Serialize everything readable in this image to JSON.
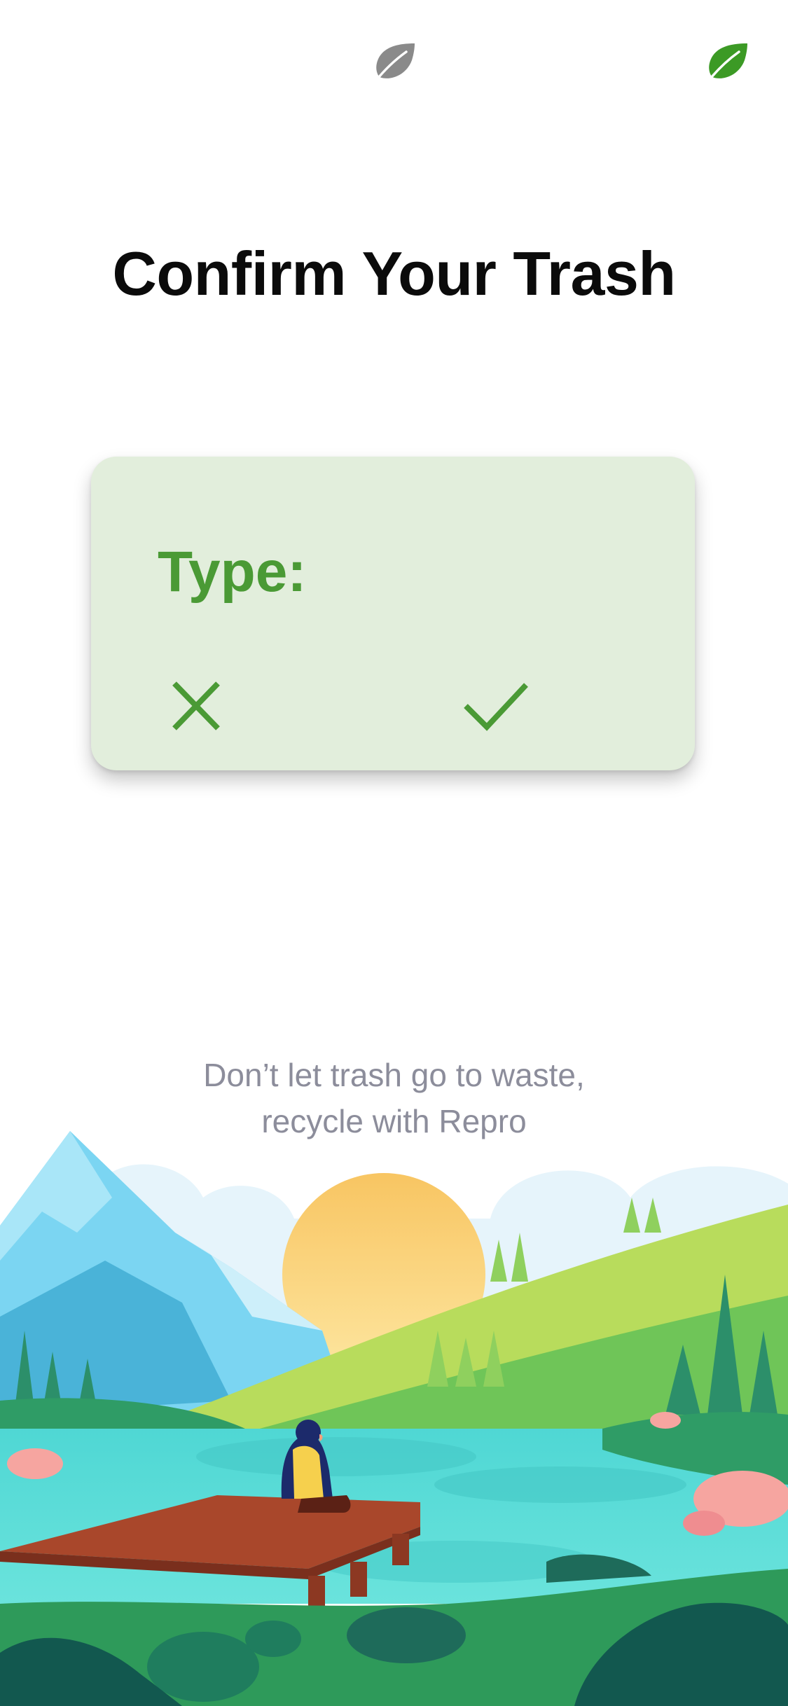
{
  "header": {
    "leaf_inactive_icon": "leaf-icon",
    "leaf_active_icon": "leaf-icon",
    "inactive_color": "#8a8a8a",
    "active_color": "#3c9a25"
  },
  "main": {
    "title": "Confirm Your Trash",
    "card": {
      "type_label": "Type:",
      "reject_icon": "close-icon",
      "confirm_icon": "check-icon",
      "background": "#e2eedc",
      "accent": "#4a9a35"
    }
  },
  "footer": {
    "tagline_line1": "Don’t let trash go to waste,",
    "tagline_line2": "recycle with Repro",
    "illustration": "nature-landscape-illustration"
  }
}
